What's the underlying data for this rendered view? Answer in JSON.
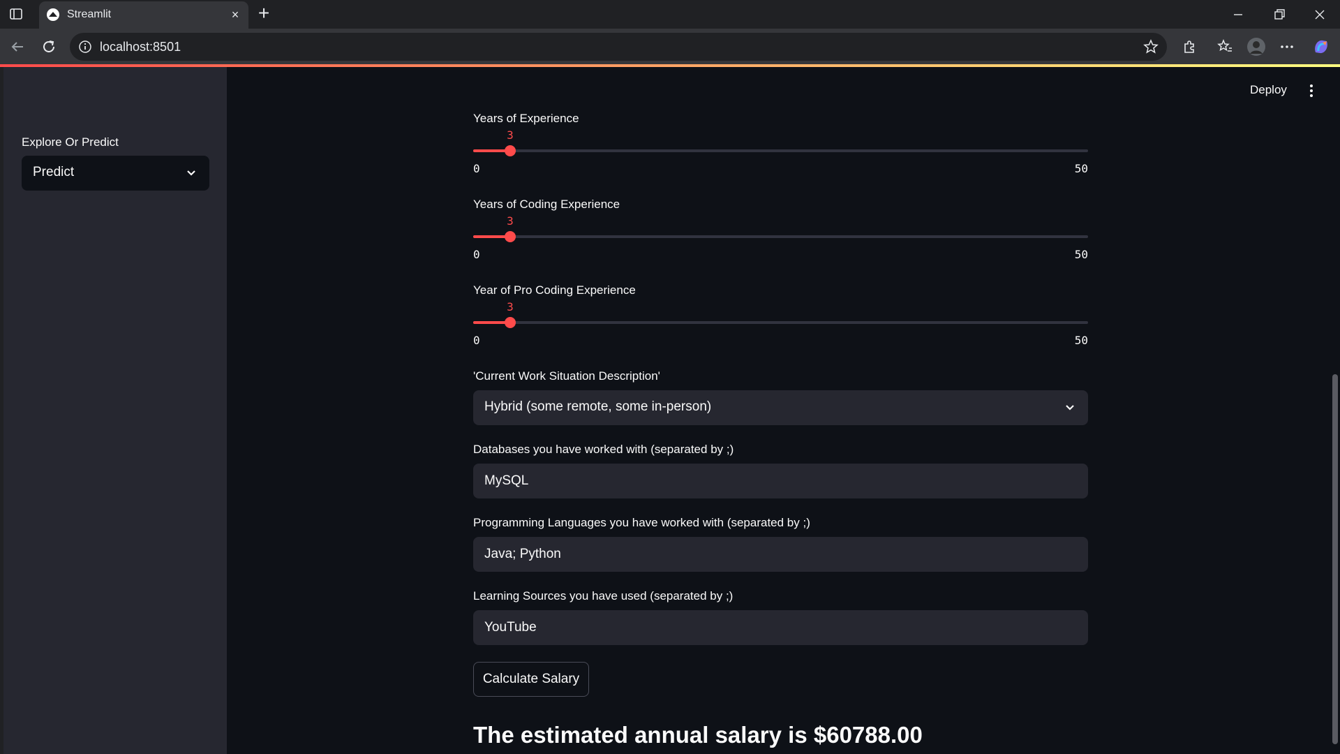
{
  "browser": {
    "tab_title": "Streamlit",
    "url": "localhost:8501"
  },
  "header": {
    "deploy_label": "Deploy"
  },
  "sidebar": {
    "label": "Explore Or Predict",
    "selected": "Predict"
  },
  "sliders": [
    {
      "label": "Years of Experience",
      "value": "3",
      "min": "0",
      "max": "50",
      "fraction": 0.06
    },
    {
      "label": "Years of Coding Experience",
      "value": "3",
      "min": "0",
      "max": "50",
      "fraction": 0.06
    },
    {
      "label": "Year of Pro Coding Experience",
      "value": "3",
      "min": "0",
      "max": "50",
      "fraction": 0.06
    }
  ],
  "work_situation": {
    "label": "'Current Work Situation Description'",
    "selected": "Hybrid (some remote, some in-person)"
  },
  "databases": {
    "label": "Databases you have worked with (separated by ;)",
    "value": "MySQL"
  },
  "languages": {
    "label": "Programming Languages you have worked with (separated by ;)",
    "value": "Java; Python"
  },
  "learning": {
    "label": "Learning Sources you have used (separated by ;)",
    "value": "YouTube"
  },
  "calculate_button": "Calculate Salary",
  "result_text": "The estimated annual salary is $60788.00",
  "colors": {
    "accent": "#ff4b4b",
    "background": "#0e1117",
    "sidebar": "#262730"
  }
}
